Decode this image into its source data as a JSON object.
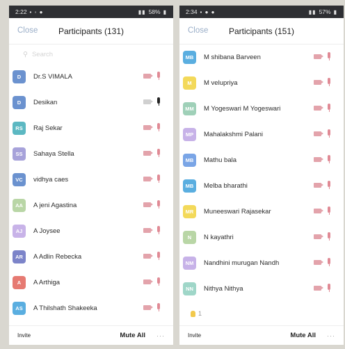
{
  "screens": [
    {
      "status": {
        "time": "2:22",
        "battery": "58%"
      },
      "header": {
        "close_label": "Close",
        "title": "Participants (131)"
      },
      "search": {
        "placeholder": "Search"
      },
      "participants": [
        {
          "initials": "D",
          "name": "Dr.S VIMALA",
          "color": "#6b92cf",
          "video": "off",
          "audio": "off"
        },
        {
          "initials": "D",
          "name": "Desikan",
          "color": "#6b92cf",
          "video": "on",
          "audio": "on"
        },
        {
          "initials": "RS",
          "name": "Raj Sekar",
          "color": "#5cb8c2",
          "video": "off",
          "audio": "off"
        },
        {
          "initials": "SS",
          "name": "Sahaya Stella",
          "color": "#a7a2da",
          "video": "off",
          "audio": "off"
        },
        {
          "initials": "VC",
          "name": "vidhya caes",
          "color": "#6b92cf",
          "video": "off",
          "audio": "off"
        },
        {
          "initials": "AA",
          "name": "A jeni Agastina",
          "color": "#b9d6a6",
          "video": "off",
          "audio": "off"
        },
        {
          "initials": "AJ",
          "name": "A Joysee",
          "color": "#c8b3e8",
          "video": "off",
          "audio": "off"
        },
        {
          "initials": "AR",
          "name": "A Adlin Rebecka",
          "color": "#7c84c9",
          "video": "off",
          "audio": "off"
        },
        {
          "initials": "A",
          "name": "A Arthiga",
          "color": "#e67a72",
          "video": "off",
          "audio": "off"
        },
        {
          "initials": "AS",
          "name": "A Thilshath Shakeeka",
          "color": "#5aaee0",
          "video": "off",
          "audio": "off"
        }
      ],
      "footer": {
        "invite_label": "Invite",
        "mute_all_label": "Mute All",
        "more_label": "···"
      }
    },
    {
      "status": {
        "time": "2:34",
        "battery": "57%"
      },
      "header": {
        "close_label": "Close",
        "title": "Participants (151)"
      },
      "hand_count": "1",
      "participants": [
        {
          "initials": "MB",
          "name": "M shibana Barveen",
          "color": "#5aaee0",
          "video": "off",
          "audio": "off"
        },
        {
          "initials": "M",
          "name": "M velupriya",
          "color": "#f3d95a",
          "video": "off",
          "audio": "off"
        },
        {
          "initials": "MM",
          "name": "M Yogeswari M Yogeswari",
          "color": "#9fd0b8",
          "video": "off",
          "audio": "off"
        },
        {
          "initials": "MP",
          "name": "Mahalakshmi Palani",
          "color": "#c7b2e8",
          "video": "off",
          "audio": "off"
        },
        {
          "initials": "MB",
          "name": "Mathu bala",
          "color": "#7aa5e6",
          "video": "off",
          "audio": "off"
        },
        {
          "initials": "MB",
          "name": "Melba bharathi",
          "color": "#5aaee0",
          "video": "off",
          "audio": "off"
        },
        {
          "initials": "MR",
          "name": "Muneeswari Rajasekar",
          "color": "#f3d95a",
          "video": "off",
          "audio": "off"
        },
        {
          "initials": "N",
          "name": "N kayathri",
          "color": "#b9d6a6",
          "video": "off",
          "audio": "off"
        },
        {
          "initials": "NM",
          "name": "Nandhini murugan Nandh",
          "color": "#c7b2e8",
          "video": "off",
          "audio": "off"
        },
        {
          "initials": "NN",
          "name": "Nithya Nithya",
          "color": "#9fd6c8",
          "video": "off",
          "audio": "off"
        }
      ],
      "footer": {
        "invite_label": "Invite",
        "mute_all_label": "Mute All",
        "more_label": "···"
      }
    }
  ]
}
